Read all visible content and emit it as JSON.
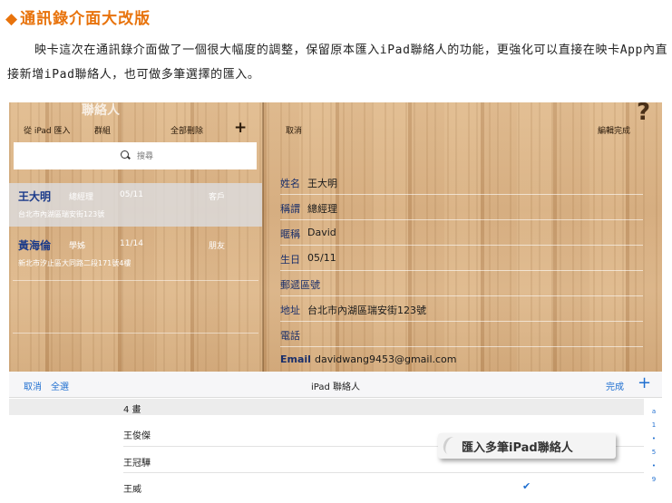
{
  "article": {
    "heading_marker": "◆",
    "heading": "通訊錄介面大改版",
    "paragraph": "映卡這次在通訊錄介面做了一個很大幅度的調整，保留原本匯入iPad聯絡人的功能，更強化可以直接在映卡App內直接新增iPad聯絡人，也可做多筆選擇的匯入。"
  },
  "app": {
    "left_panel": {
      "title": "聯絡人",
      "import_label": "從 iPad 匯入",
      "group_label": "群組",
      "delete_all_label": "全部刪除",
      "add_label": "+",
      "search_placeholder": "搜尋",
      "contacts": [
        {
          "name": "王大明",
          "title": "總經理",
          "date": "05/11",
          "group": "客戶",
          "address": "台北市內湖區瑞安街123號"
        },
        {
          "name": "黃海倫",
          "title": "學姊",
          "date": "11/14",
          "group": "朋友",
          "address": "新北市汐止區大同路二段171號4樓"
        }
      ]
    },
    "right_panel": {
      "cancel_label": "取消",
      "edit_done_label": "編輯完成",
      "help_label": "?",
      "fields": [
        {
          "label": "姓名",
          "value": "王大明"
        },
        {
          "label": "稱謂",
          "value": "總經理"
        },
        {
          "label": "暱稱",
          "value": "David"
        },
        {
          "label": "生日",
          "value": "05/11"
        },
        {
          "label": "郵遞區號",
          "value": ""
        },
        {
          "label": "地址",
          "value": "台北市內湖區瑞安街123號"
        },
        {
          "label": "電話",
          "value": ""
        },
        {
          "label": "Email",
          "value": "davidwang9453@gmail.com"
        }
      ]
    }
  },
  "picker": {
    "cancel_label": "取消",
    "select_all_label": "全選",
    "title": "iPad 聯絡人",
    "done_label": "完成",
    "add_label": "+",
    "section": "4 畫",
    "items": [
      "王俊傑",
      "王冠驊",
      "王威"
    ],
    "checked_item_index": 2,
    "check_mark": "✔",
    "index_letters": [
      "a",
      "1",
      "•",
      "5",
      "•",
      "9"
    ],
    "callout": "匯入多筆iPad聯絡人"
  }
}
